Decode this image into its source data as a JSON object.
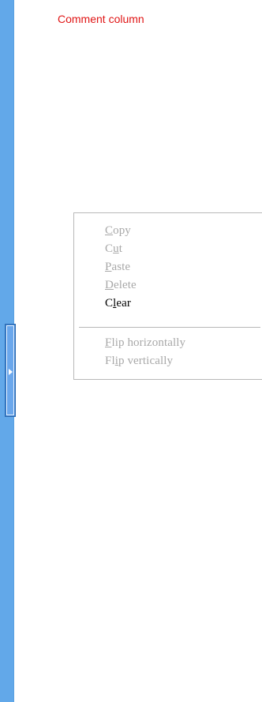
{
  "header": {
    "comment_column": "Comment column"
  },
  "context_menu": {
    "items": [
      {
        "id": "copy",
        "prefix": "",
        "mnemonic": "C",
        "suffix": "opy",
        "enabled": false
      },
      {
        "id": "cut",
        "prefix": "C",
        "mnemonic": "u",
        "suffix": "t",
        "enabled": false
      },
      {
        "id": "paste",
        "prefix": "",
        "mnemonic": "P",
        "suffix": "aste",
        "enabled": false
      },
      {
        "id": "delete",
        "prefix": "",
        "mnemonic": "D",
        "suffix": "elete",
        "enabled": false
      },
      {
        "id": "clear",
        "prefix": "C",
        "mnemonic": "l",
        "suffix": "ear",
        "enabled": true
      },
      {
        "id": "flip-horizontally",
        "prefix": "",
        "mnemonic": "F",
        "suffix": "lip horizontally",
        "enabled": false
      },
      {
        "id": "flip-vertically",
        "prefix": "Fl",
        "mnemonic": "i",
        "suffix": "p vertically",
        "enabled": false
      }
    ]
  },
  "colors": {
    "rail": "#62a8e9",
    "rail_handle": "#3e84d2",
    "comment_text": "#e01515",
    "menu_disabled_text": "#a8a8a8",
    "menu_enabled_text": "#000000",
    "menu_border": "#b8b8b8"
  },
  "icons": {
    "rail_handle_arrow": "triangle-right-icon"
  }
}
